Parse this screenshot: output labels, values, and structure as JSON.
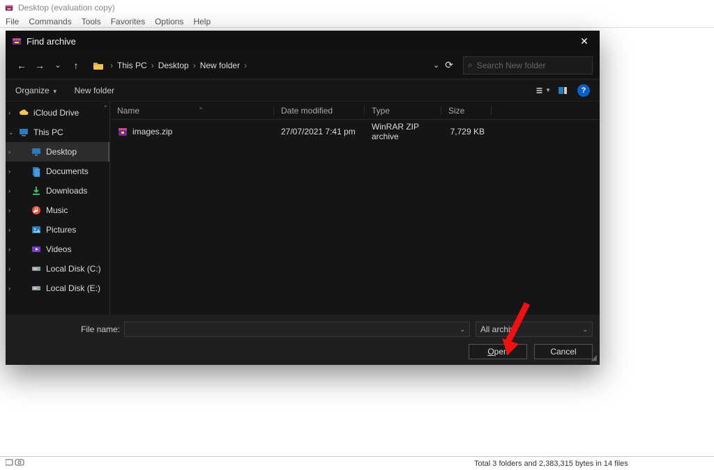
{
  "winrar": {
    "title": "Desktop (evaluation copy)",
    "menu": [
      "File",
      "Commands",
      "Tools",
      "Favorites",
      "Options",
      "Help"
    ]
  },
  "statusbar": {
    "text": "Total 3 folders and 2,383,315 bytes in 14 files"
  },
  "dialog": {
    "title": "Find archive",
    "breadcrumb": [
      "This PC",
      "Desktop",
      "New folder"
    ],
    "search_placeholder": "Search New folder",
    "organize": "Organize",
    "newfolder": "New folder",
    "columns": {
      "name": "Name",
      "date": "Date modified",
      "type": "Type",
      "size": "Size"
    },
    "rows": [
      {
        "name": "images.zip",
        "date": "27/07/2021 7:41 pm",
        "type": "WinRAR ZIP archive",
        "size": "7,729 KB"
      }
    ],
    "sidebar": {
      "items": [
        {
          "label": "iCloud Drive",
          "icon": "icloud",
          "exp": ">",
          "sub": false
        },
        {
          "label": "This PC",
          "icon": "pc",
          "exp": "v",
          "sub": false
        },
        {
          "label": "Desktop",
          "icon": "desktop",
          "exp": ">",
          "sub": true,
          "sel": true
        },
        {
          "label": "Documents",
          "icon": "documents",
          "exp": ">",
          "sub": true
        },
        {
          "label": "Downloads",
          "icon": "downloads",
          "exp": ">",
          "sub": true
        },
        {
          "label": "Music",
          "icon": "music",
          "exp": ">",
          "sub": true
        },
        {
          "label": "Pictures",
          "icon": "pictures",
          "exp": ">",
          "sub": true
        },
        {
          "label": "Videos",
          "icon": "videos",
          "exp": ">",
          "sub": true
        },
        {
          "label": "Local Disk (C:)",
          "icon": "disk",
          "exp": ">",
          "sub": true
        },
        {
          "label": "Local Disk (E:)",
          "icon": "disk",
          "exp": ">",
          "sub": true
        }
      ]
    },
    "filename_label": "File name:",
    "filter_label": "All archiv",
    "open": "Open",
    "cancel": "Cancel"
  }
}
